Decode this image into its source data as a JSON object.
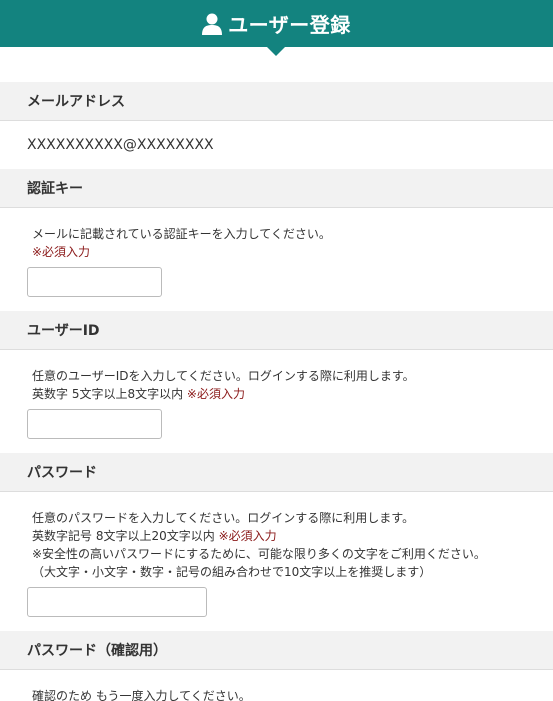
{
  "header": {
    "title": "ユーザー登録",
    "icon": "user-icon",
    "bg_color": "#13837f"
  },
  "email_section": {
    "label": "メールアドレス",
    "value": "XXXXXXXXXX@XXXXXXXX"
  },
  "auth_key_section": {
    "label": "認証キー",
    "description": "メールに記載されている認証キーを入力してください。",
    "required_note": "※必須入力",
    "input_value": ""
  },
  "user_id_section": {
    "label": "ユーザーID",
    "description": "任意のユーザーIDを入力してください。ログインする際に利用します。",
    "rule": "英数字 5文字以上8文字以内",
    "required_note": "※必須入力",
    "input_value": ""
  },
  "password_section": {
    "label": "パスワード",
    "description": "任意のパスワードを入力してください。ログインする際に利用します。",
    "rule": "英数字記号 8文字以上20文字以内",
    "required_note": "※必須入力",
    "note_1": "※安全性の高いパスワードにするために、可能な限り多くの文字をご利用ください。",
    "note_2": "（大文字・小文字・数字・記号の組み合わせで10文字以上を推奨します）",
    "input_value": ""
  },
  "password_confirm_section": {
    "label": "パスワード（確認用）",
    "description": "確認のため もう一度入力してください。"
  }
}
